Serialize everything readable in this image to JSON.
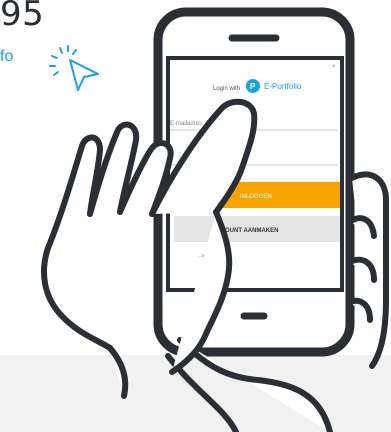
{
  "header": {
    "price_fragment": "95",
    "info_link": "fo"
  },
  "phone_screen": {
    "login_with": "Login with",
    "brand_name": "E-Portfolio",
    "brand_logo": "P",
    "close_glyph": "×",
    "email_placeholder": "E-mailadres",
    "login_button": "INLOGGEN",
    "create_account_button": "ACCOUNT AANMAKEN",
    "forgot_link": "...wachtwoord?"
  },
  "colors": {
    "accent_orange": "#f7a400",
    "brand_blue": "#1da1e4",
    "line_dark": "#2a2f36",
    "band_grey": "#f1f1f1"
  },
  "icons": [
    "cursor-click-icon",
    "phone-speaker-icon",
    "phone-home-button-icon"
  ]
}
